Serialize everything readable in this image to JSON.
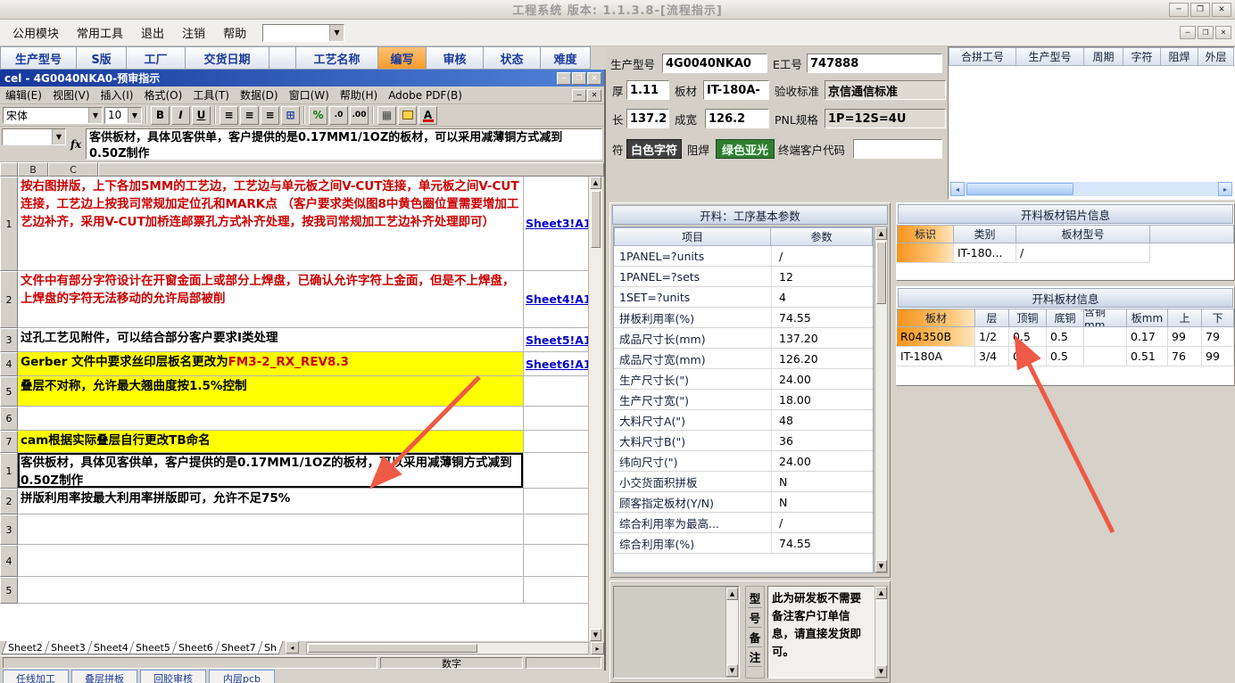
{
  "colors": {
    "annotation_arrow": "#ee5a45",
    "row_highlight": "#ffff00",
    "alert_text": "#cc0000",
    "excel_title_blue": "#16379c"
  },
  "icons": {
    "dropdown": "▼",
    "up": "▲",
    "down": "▼",
    "left": "◂",
    "right": "▸",
    "min": "─",
    "max": "❐",
    "close": "✕",
    "align": "≡",
    "merge": "⊞",
    "borders": "▦"
  },
  "app": {
    "title": "工程系统 版本: 1.1.3.8-[流程指示]",
    "menu_items": [
      "公用模块",
      "常用工具",
      "退出",
      "注销",
      "帮助"
    ]
  },
  "bg_header": {
    "cells": [
      "生产型号",
      "S版",
      "工厂",
      "交货日期",
      "工艺名称",
      "编写",
      "审核",
      "状态",
      "难度"
    ]
  },
  "info": {
    "model_label": "生产型号",
    "model": "4G0040NKA0",
    "ejob_label": "E工号",
    "ejob": "747888",
    "thickness_label": "厚",
    "thickness": "1.11",
    "material_label": "板材",
    "material": "IT-180A-",
    "standard_label": "验收标准",
    "standard": "京信通信标准",
    "length_label": "长",
    "length": "137.2",
    "width_label": "成宽",
    "width": "126.2",
    "pnl_label": "PNL规格",
    "pnl": "1P=12S=4U",
    "char_label": "符",
    "char_value": "白色字符",
    "mask_label": "阻焊",
    "mask_value": "绿色亚光",
    "endcust_label": "终端客户代码",
    "endcust_value": ""
  },
  "jointable": {
    "headers": [
      "合拼工号",
      "生产型号",
      "周期",
      "字符",
      "阻焊",
      "外层"
    ]
  },
  "params": {
    "title": "开料：工序基本参数",
    "col_item": "项目",
    "col_value": "参数",
    "rows": [
      {
        "label": "1PANEL=?units",
        "value": "/"
      },
      {
        "label": "1PANEL=?sets",
        "value": "12"
      },
      {
        "label": "1SET=?units",
        "value": "4"
      },
      {
        "label": "拼板利用率(%)",
        "value": "74.55"
      },
      {
        "label": "成品尺寸长(mm)",
        "value": "137.20"
      },
      {
        "label": "成品尺寸宽(mm)",
        "value": "126.20"
      },
      {
        "label": "生产尺寸长(\")",
        "value": "24.00"
      },
      {
        "label": "生产尺寸宽(\")",
        "value": "18.00"
      },
      {
        "label": "大料尺寸A(\")",
        "value": "48"
      },
      {
        "label": "大料尺寸B(\")",
        "value": "36"
      },
      {
        "label": "纬向尺寸(\")",
        "value": "24.00"
      },
      {
        "label": "小交货面积拼板",
        "value": "N"
      },
      {
        "label": "顾客指定板材(Y/N)",
        "value": "N"
      },
      {
        "label": "综合利用率为最高...",
        "value": "/"
      },
      {
        "label": "综合利用率(%)",
        "value": "74.55"
      }
    ]
  },
  "alum": {
    "title": "开料板材铝片信息",
    "headers": [
      "标识",
      "类别",
      "板材型号"
    ],
    "row": {
      "category": "IT-180...",
      "model": "/"
    }
  },
  "boards": {
    "title": "开料板材信息",
    "headers": [
      "板材",
      "层",
      "顶铜",
      "底铜",
      "含铜mm",
      "板mm",
      "上",
      "下"
    ],
    "rows": [
      {
        "cells": [
          "R04350B",
          "1/2",
          "0.5",
          "0.5",
          "",
          "0.17",
          "99",
          "79"
        ]
      },
      {
        "cells": [
          "IT-180A",
          "3/4",
          "0.5",
          "0.5",
          "",
          "0.51",
          "76",
          "99"
        ]
      }
    ]
  },
  "note": {
    "tab_chars": [
      "型",
      "号",
      "备",
      "注"
    ],
    "text": "此为研发板不需要备注客户订单信息，请直接发货即可。"
  },
  "bottom_tabs": [
    "任线加工",
    "叠层拼板",
    "回胶审核",
    "内层pcb"
  ],
  "excel": {
    "title": "cel - 4G0040NKA0-预审指示",
    "menus": [
      "编辑(E)",
      "视图(V)",
      "插入(I)",
      "格式(O)",
      "工具(T)",
      "数据(D)",
      "窗口(W)",
      "帮助(H)",
      "Adobe PDF(B)"
    ],
    "toolbar": {
      "font": "宋体",
      "size": "10",
      "bold": "B",
      "italic": "I",
      "underline": "U",
      "percent": "%",
      "inc_decimal": ".0",
      "dec_decimal": ".00",
      "fontcolor": "A",
      "fx": "fx"
    },
    "formula_text": "客供板材，具体见客供单，客户提供的是0.17MM1/1OZ的板材，可以采用减薄铜方式减到0.50Z制作",
    "col_b": "B",
    "col_c": "C",
    "rows": [
      {
        "num": "1",
        "text": "按右图拼版，上下各加5MM的工艺边，工艺边与单元板之间V-CUT连接，单元板之间V-CUT连接，工艺边上按我司常规加定位孔和MARK点 （客户要求类似图8中黄色圈位置需要增加工艺边补齐，采用V-CUT加桥连邮票孔方式补齐处理，按我司常规加工艺边补齐处理即可）",
        "link": "Sheet3!A1"
      },
      {
        "num": "2",
        "text": "文件中有部分字符设计在开窗金面上或部分上焊盘，已确认允许字符上金面，但是不上焊盘，上焊盘的字符无法移动的允许局部被削",
        "link": "Sheet4!A1"
      },
      {
        "num": "3",
        "text": "过孔工艺见附件，可以结合部分客户要求I类处理",
        "link": "Sheet5!A1"
      },
      {
        "num": "4",
        "text_a": "Gerber 文件中要求丝印层板名更改为",
        "text_b": "FM3-2_RX_REV8.3",
        "link": "Sheet6!A1"
      },
      {
        "num": "5",
        "text": "叠层不对称，允许最大翘曲度按1.5%控制"
      },
      {
        "num": "6",
        "text": ""
      },
      {
        "num": "7",
        "text": "cam根据实际叠层自行更改TB命名"
      },
      {
        "num": "1",
        "text": "客供板材，具体见客供单，客户提供的是0.17MM1/1OZ的板材，可以采用减薄铜方式减到0.50Z制作"
      },
      {
        "num": "2",
        "text": "拼版利用率按最大利用率拼版即可，允许不足75%"
      },
      {
        "num": "3",
        "text": ""
      },
      {
        "num": "4",
        "text": ""
      },
      {
        "num": "5",
        "text": ""
      }
    ],
    "sheet_tabs": [
      "Sheet2",
      "Sheet3",
      "Sheet4",
      "Sheet5",
      "Sheet6",
      "Sheet7",
      "Sh"
    ],
    "status_mode": "数字"
  }
}
